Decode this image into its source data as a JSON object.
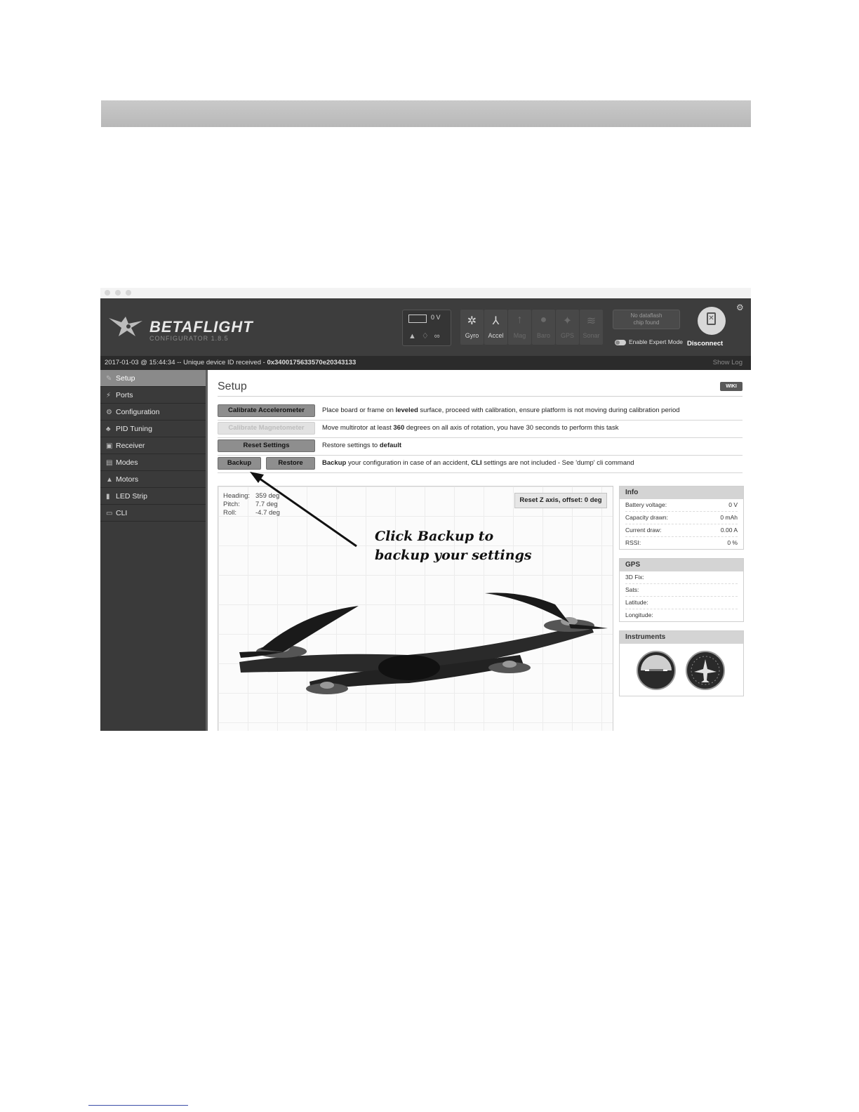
{
  "app": {
    "logo_name": "BETAFLIGHT",
    "logo_sub": "CONFIGURATOR  1.8.5"
  },
  "header": {
    "battery_voltage": "0 V",
    "sensors": [
      {
        "label": "Gyro",
        "icon": "gyro-icon",
        "active": true
      },
      {
        "label": "Accel",
        "icon": "accel-icon",
        "active": true
      },
      {
        "label": "Mag",
        "icon": "mag-icon",
        "active": false
      },
      {
        "label": "Baro",
        "icon": "baro-icon",
        "active": false
      },
      {
        "label": "GPS",
        "icon": "gps-icon",
        "active": false
      },
      {
        "label": "Sonar",
        "icon": "sonar-icon",
        "active": false
      }
    ],
    "dataflash_line1": "No dataflash",
    "dataflash_line2": "chip found",
    "expert_mode_label": "Enable Expert Mode",
    "disconnect_label": "Disconnect"
  },
  "status": {
    "text": "2017-01-03 @ 15:44:34 -- Unique device ID received - ",
    "device_id": "0x3400175633570e20343133",
    "show_log": "Show Log"
  },
  "sidebar": {
    "items": [
      {
        "label": "Setup",
        "icon": "wrench-icon",
        "active": true
      },
      {
        "label": "Ports",
        "icon": "plug-icon"
      },
      {
        "label": "Configuration",
        "icon": "gear-icon"
      },
      {
        "label": "PID Tuning",
        "icon": "sliders-icon"
      },
      {
        "label": "Receiver",
        "icon": "receiver-icon"
      },
      {
        "label": "Modes",
        "icon": "modes-icon"
      },
      {
        "label": "Motors",
        "icon": "motor-icon"
      },
      {
        "label": "LED Strip",
        "icon": "led-icon"
      },
      {
        "label": "CLI",
        "icon": "terminal-icon"
      }
    ]
  },
  "setup": {
    "title": "Setup",
    "wiki": "WIKI",
    "calibrate_accel": {
      "button": "Calibrate Accelerometer",
      "pre": "Place board or frame on ",
      "bold": "leveled",
      "post": " surface, proceed with calibration, ensure platform is not moving during calibration period"
    },
    "calibrate_mag": {
      "button": "Calibrate Magnetometer",
      "pre": "Move multirotor at least ",
      "bold": "360",
      "post": " degrees on all axis of rotation, you have 30 seconds to perform this task"
    },
    "reset": {
      "button": "Reset Settings",
      "pre": "Restore settings to ",
      "bold": "default"
    },
    "backup": {
      "backup_button": "Backup",
      "restore_button": "Restore",
      "bold1": "Backup",
      "mid": " your configuration in case of an accident, ",
      "bold2": "CLI",
      "post": " settings are not included - See 'dump' cli command"
    },
    "attitude": {
      "heading_label": "Heading:",
      "heading_value": "359 deg",
      "pitch_label": "Pitch:",
      "pitch_value": "7.7 deg",
      "roll_label": "Roll:",
      "roll_value": "-4.7 deg"
    },
    "reset_z": "Reset Z axis, offset: 0 deg"
  },
  "info": {
    "title": "Info",
    "rows": [
      {
        "label": "Battery voltage:",
        "value": "0 V"
      },
      {
        "label": "Capacity drawn:",
        "value": "0 mAh"
      },
      {
        "label": "Current draw:",
        "value": "0.00 A"
      },
      {
        "label": "RSSI:",
        "value": "0 %"
      }
    ]
  },
  "gps": {
    "title": "GPS",
    "rows": [
      {
        "label": "3D Fix:"
      },
      {
        "label": "Sats:"
      },
      {
        "label": "Latitude:"
      },
      {
        "label": "Longitude:"
      }
    ]
  },
  "instruments": {
    "title": "Instruments"
  },
  "annotation": {
    "line1": "Click Backup to",
    "line2": "backup your settings"
  }
}
